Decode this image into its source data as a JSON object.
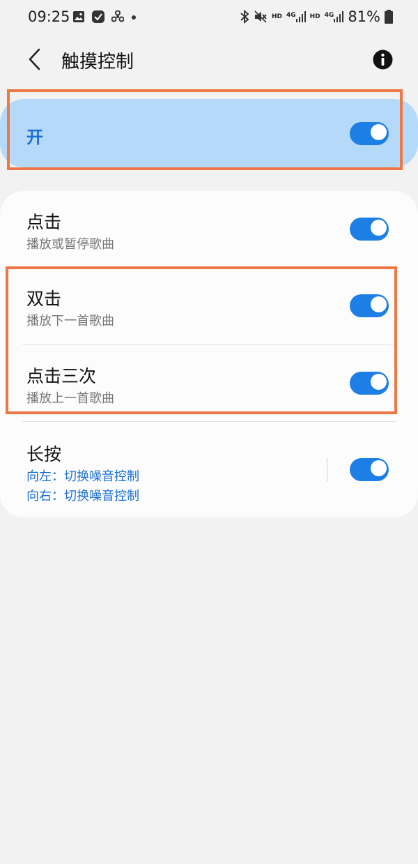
{
  "status_bar": {
    "time": "09:25",
    "battery": "81%",
    "icons": [
      "gallery-icon",
      "check-badge-icon",
      "fan-icon",
      "dot-icon",
      "bluetooth-icon",
      "mute-icon",
      "hd-icon",
      "4g-signal-icon",
      "hd-icon",
      "4g-signal-icon",
      "battery-icon"
    ],
    "hd_label": "HD",
    "net_label": "4G"
  },
  "header": {
    "title": "触摸控制"
  },
  "master_switch": {
    "label": "开",
    "on": true
  },
  "settings": [
    {
      "title": "点击",
      "subtitle": "播放或暂停歌曲",
      "on": true
    },
    {
      "title": "双击",
      "subtitle": "播放下一首歌曲",
      "on": true
    },
    {
      "title": "点击三次",
      "subtitle": "播放上一首歌曲",
      "on": true
    },
    {
      "title": "长按",
      "left_action": "向左：切换噪音控制",
      "right_action": "向右：切换噪音控制",
      "on": true
    }
  ],
  "colors": {
    "accent": "#1d7fe5",
    "highlight_bg": "#b5d9f8",
    "annotation_border": "#ee7746"
  }
}
